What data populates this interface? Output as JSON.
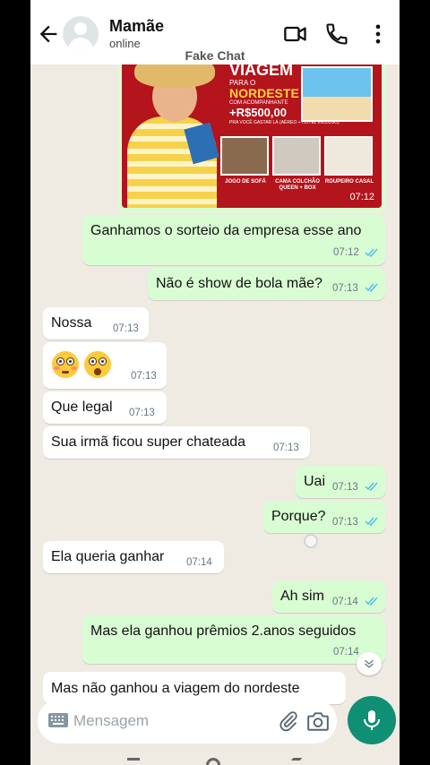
{
  "header": {
    "contact_name": "Mamãe",
    "status": "online",
    "banner": "Fake Chat"
  },
  "image_message": {
    "time": "07:12",
    "ad": {
      "headline": "VIAGEM",
      "line2": "PARA O",
      "destination": "NORDESTE",
      "line4": "COM ACOMPANHANTE",
      "amount": "+R$500,00",
      "line6": "PRA VOCÊ GASTAR LÁ (AÉREO + HOTEL INCLUSO)",
      "prize1": "JOGO DE SOFÁ",
      "prize2": "CAMA COLCHÃO QUEEN + BOX",
      "prize3": "ROUPEIRO CASAL"
    }
  },
  "messages": [
    {
      "dir": "out",
      "text": "Ganhamos o sorteio da empresa esse ano",
      "time": "07:12"
    },
    {
      "dir": "out",
      "text": "Não é show de bola mãe?",
      "time": "07:13"
    },
    {
      "dir": "in",
      "text": "Nossa",
      "time": "07:13"
    },
    {
      "dir": "in",
      "text": "😳😲",
      "time": "07:13"
    },
    {
      "dir": "in",
      "text": "Que legal",
      "time": "07:13"
    },
    {
      "dir": "in",
      "text": "Sua irmã ficou super chateada",
      "time": "07:13"
    },
    {
      "dir": "out",
      "text": "Uai",
      "time": "07:13"
    },
    {
      "dir": "out",
      "text": "Porque?",
      "time": "07:13"
    },
    {
      "dir": "in",
      "text": "Ela queria ganhar",
      "time": "07:14"
    },
    {
      "dir": "out",
      "text": "Ah sim",
      "time": "07:14"
    },
    {
      "dir": "out",
      "text": "Mas ela ganhou prêmios 2.anos seguidos",
      "time": "07:14"
    },
    {
      "dir": "in",
      "text": "Mas não ganhou a viagem do nordeste",
      "time": ""
    }
  ],
  "composer": {
    "placeholder": "Mensagem"
  },
  "icons": [
    "back-arrow-icon",
    "video-call-icon",
    "phone-icon",
    "more-vert-icon",
    "keyboard-icon",
    "attach-icon",
    "camera-icon",
    "mic-icon",
    "chevron-down-icon",
    "double-check-icon"
  ],
  "colors": {
    "outgoing_bubble": "#d9fdd3",
    "incoming_bubble": "#ffffff",
    "chat_background": "#efeae2",
    "accent": "#0f8f74",
    "read_tick": "#53bdeb"
  }
}
